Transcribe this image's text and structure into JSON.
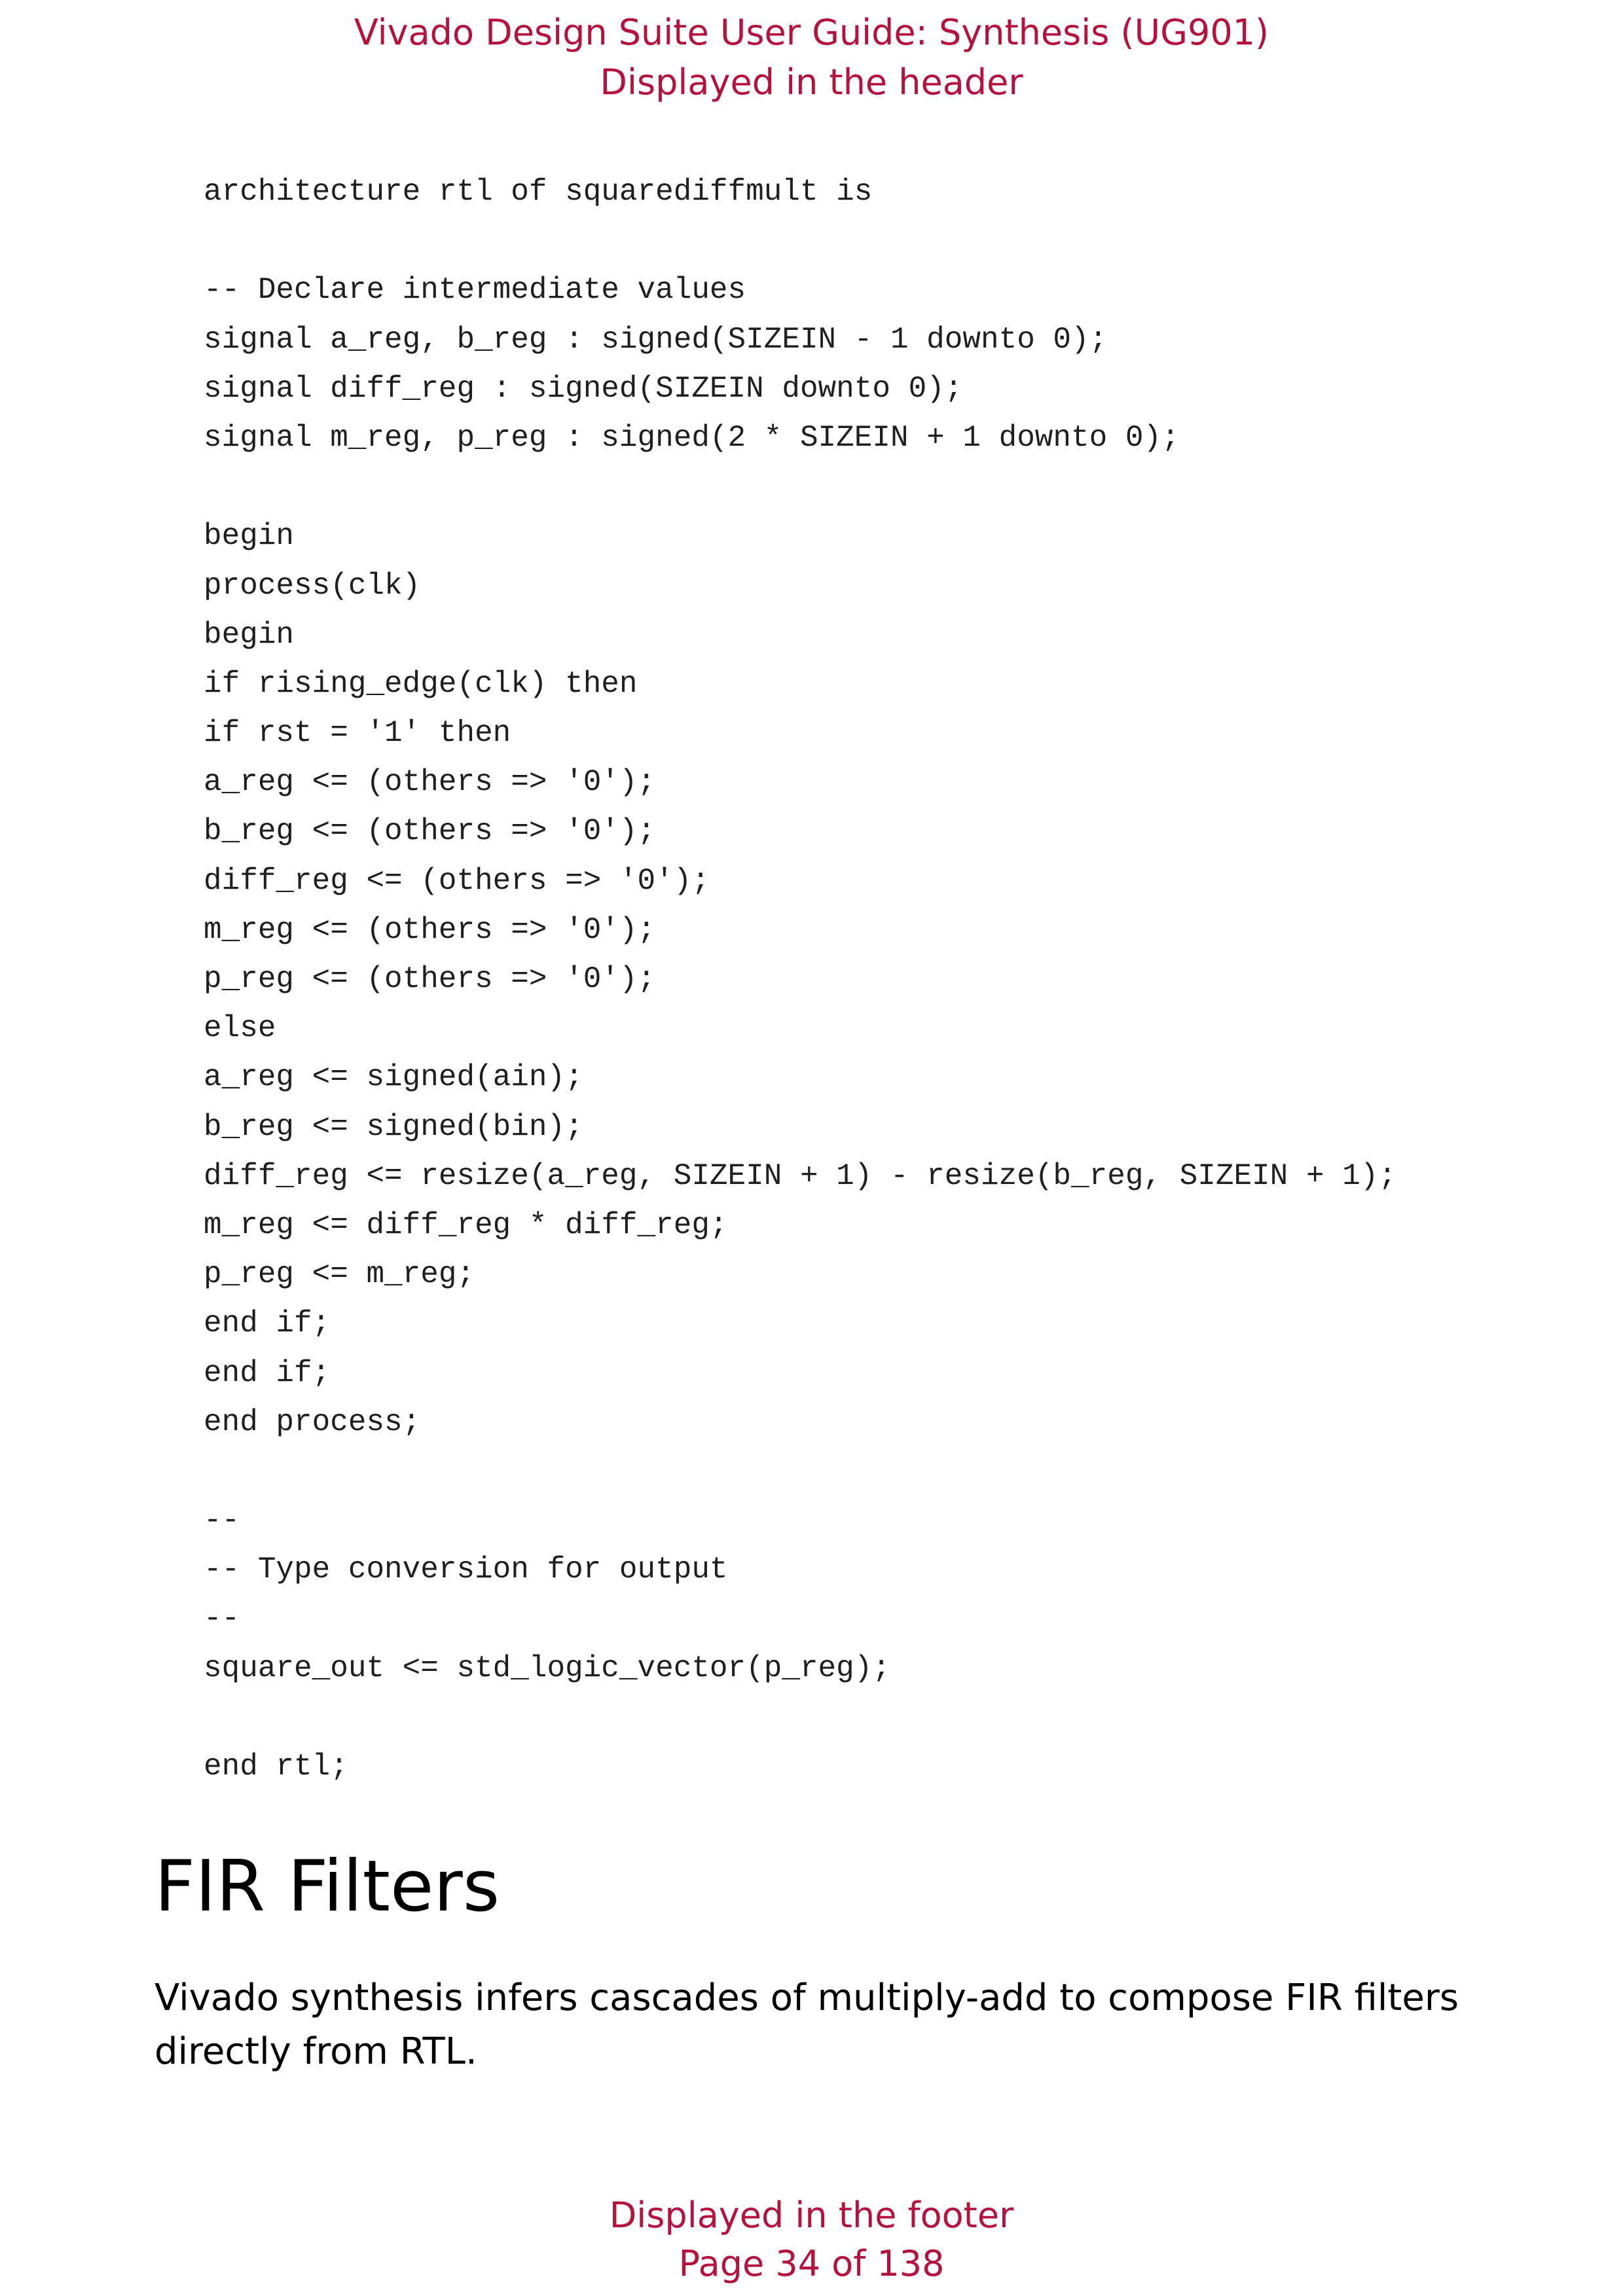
{
  "header": {
    "title": "Vivado Design Suite User Guide: Synthesis (UG901)",
    "subtitle": "Displayed in the header"
  },
  "code": {
    "lines": [
      "architecture rtl of squarediffmult is",
      "",
      "-- Declare intermediate values",
      "signal a_reg, b_reg : signed(SIZEIN - 1 downto 0);",
      "signal diff_reg : signed(SIZEIN downto 0);",
      "signal m_reg, p_reg : signed(2 * SIZEIN + 1 downto 0);",
      "",
      "begin",
      "process(clk)",
      "begin",
      "if rising_edge(clk) then",
      "if rst = '1' then",
      "a_reg <= (others => '0');",
      "b_reg <= (others => '0');",
      "diff_reg <= (others => '0');",
      "m_reg <= (others => '0');",
      "p_reg <= (others => '0');",
      "else",
      "a_reg <= signed(ain);",
      "b_reg <= signed(bin);",
      "diff_reg <= resize(a_reg, SIZEIN + 1) - resize(b_reg, SIZEIN + 1);",
      "m_reg <= diff_reg * diff_reg;",
      "p_reg <= m_reg;",
      "end if;",
      "end if;",
      "end process;",
      "",
      "--",
      "-- Type conversion for output",
      "--",
      "square_out <= std_logic_vector(p_reg);",
      "",
      "end rtl;"
    ]
  },
  "section": {
    "heading": "FIR Filters",
    "body": "Vivado synthesis infers cascades of multiply-add to compose FIR filters directly from RTL."
  },
  "footer": {
    "note": "Displayed in the footer",
    "page": "Page 34 of 138"
  }
}
